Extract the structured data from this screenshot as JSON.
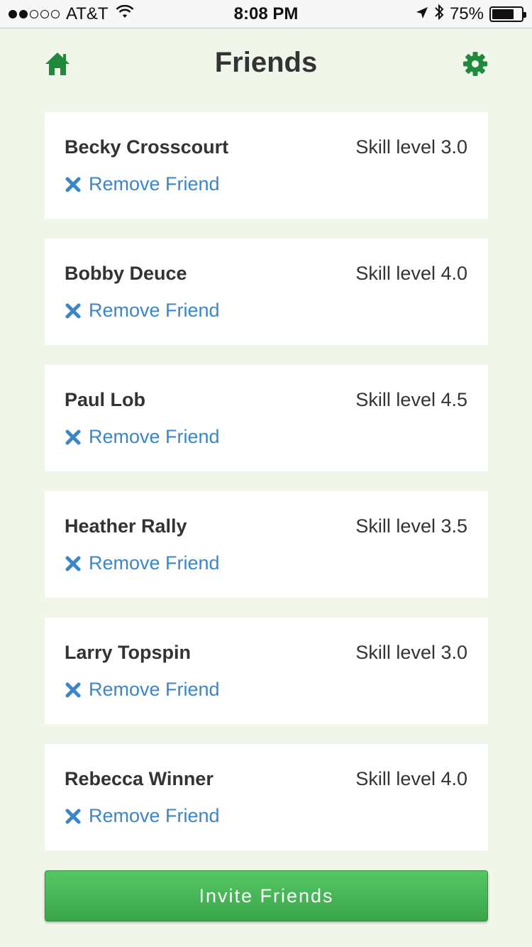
{
  "status_bar": {
    "carrier": "AT&T",
    "time": "8:08 PM",
    "battery_percent": "75%",
    "battery_level": 0.75,
    "signal_bars_filled": 2,
    "signal_bars_total": 5
  },
  "nav": {
    "title": "Friends",
    "home_icon": "home-icon",
    "settings_icon": "gear-icon"
  },
  "friends": [
    {
      "name": "Becky Crosscourt",
      "skill": "Skill level 3.0",
      "remove_label": "Remove Friend"
    },
    {
      "name": "Bobby Deuce",
      "skill": "Skill level 4.0",
      "remove_label": "Remove Friend"
    },
    {
      "name": "Paul Lob",
      "skill": "Skill level 4.5",
      "remove_label": "Remove Friend"
    },
    {
      "name": "Heather Rally",
      "skill": "Skill level 3.5",
      "remove_label": "Remove Friend"
    },
    {
      "name": "Larry Topspin",
      "skill": "Skill level 3.0",
      "remove_label": "Remove Friend"
    },
    {
      "name": "Rebecca Winner",
      "skill": "Skill level 4.0",
      "remove_label": "Remove Friend"
    }
  ],
  "invite_label": "Invite Friends",
  "colors": {
    "background": "#f0f6e9",
    "accent_green": "#1f8a3c",
    "link_blue": "#3a86c8",
    "button_green": "#4cb95c"
  }
}
